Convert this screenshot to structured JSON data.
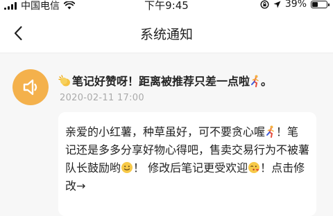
{
  "status_bar": {
    "carrier": "中国电信",
    "time": "下午9:45",
    "battery_percent": "39%",
    "battery_level": 0.39,
    "signal_icon": "signal-bars-icon",
    "wifi_icon": "wifi-icon",
    "location_icon": "location-arrow-icon",
    "orientation_lock_icon": "rotation-lock-icon"
  },
  "nav": {
    "back_icon": "chevron-left-icon",
    "title": "系统通知"
  },
  "message": {
    "avatar_icon": "speaker-icon",
    "avatar_color": "#f4b14c",
    "title_prefix_emoji": "clapping-hands-emoji",
    "title": "笔记好赞呀！距离被推荐只差一点啦",
    "title_suffix_emoji": "running-person-emoji",
    "title_end": "。",
    "time": "2020-02-11 17:00",
    "body_part1": "亲爱的小红薯，种草虽好，可不要贪心喔",
    "body_emoji1": "running-person-emoji",
    "body_part2": "！笔记还是多多分享好物心得吧，售卖交易行为不被薯队长鼓励哟",
    "body_emoji2": "smiling-face-emoji",
    "body_part3": "！ 修改后笔记更受欢迎",
    "body_emoji3": "face-blowing-kiss-emoji",
    "body_part4": "！点击修改→"
  }
}
